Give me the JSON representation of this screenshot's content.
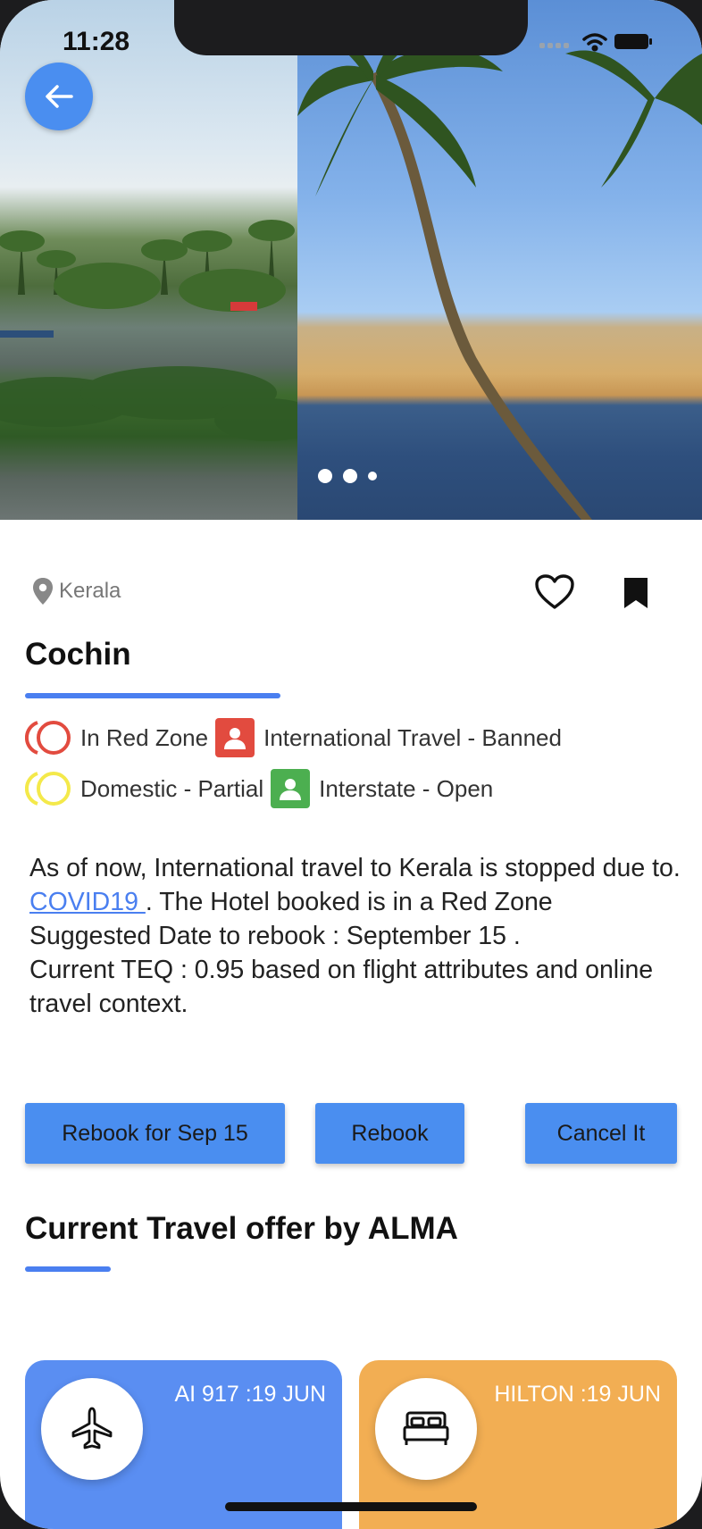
{
  "status_bar": {
    "time": "11:28"
  },
  "hero": {
    "slide_count": 3,
    "active_slide": 1
  },
  "location": {
    "region": "Kerala"
  },
  "destination": {
    "title": "Cochin"
  },
  "restrictions": {
    "red_zone": "In Red Zone",
    "international": "International Travel  - Banned",
    "domestic": "Domestic - Partial",
    "interstate": "Interstate - Open"
  },
  "description": {
    "part1": "As of now, International travel to Kerala is stopped due to. ",
    "link": "COVID19 ",
    "part2": " . The Hotel booked is in a Red Zone",
    "line2": "Suggested Date to rebook : September 15 .",
    "line3": "Current TEQ : 0.95 based on flight attributes and online travel context."
  },
  "actions": {
    "rebook_date": "Rebook for Sep 15",
    "rebook": "Rebook",
    "cancel": "Cancel It"
  },
  "offers": {
    "section_title": "Current Travel offer by ALMA",
    "cards": [
      {
        "label": "AI 917 :19 JUN",
        "icon": "airplane-icon"
      },
      {
        "label": "HILTON :19 JUN",
        "icon": "bed-icon"
      }
    ]
  },
  "colors": {
    "accent": "#4a8ef0",
    "red_zone": "#e24b3f",
    "partial": "#f4e94a",
    "open": "#4caf50",
    "offer_blue": "#5a8ef2",
    "offer_orange": "#f2ae53"
  }
}
